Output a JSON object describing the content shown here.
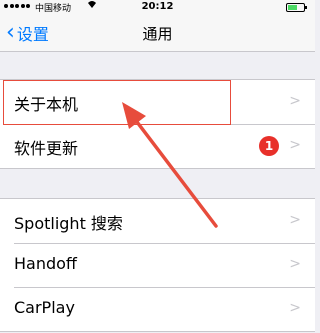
{
  "status_bar": {
    "carrier": "中国移动",
    "wifi_icon": "wifi-icon",
    "time": "20:12",
    "battery_level": 0.7
  },
  "nav": {
    "back_label": "设置",
    "title": "通用"
  },
  "group1": {
    "items": [
      {
        "label": "关于本机"
      },
      {
        "label": "软件更新",
        "badge": "1"
      }
    ]
  },
  "group2": {
    "items": [
      {
        "label": "Spotlight 搜索"
      },
      {
        "label": "Handoff"
      },
      {
        "label": "CarPlay"
      }
    ]
  },
  "chevron_glyph": ">",
  "colors": {
    "accent": "#007aff",
    "badge": "#e8302a",
    "annotation": "#e74c3c",
    "background": "#efeff4"
  }
}
